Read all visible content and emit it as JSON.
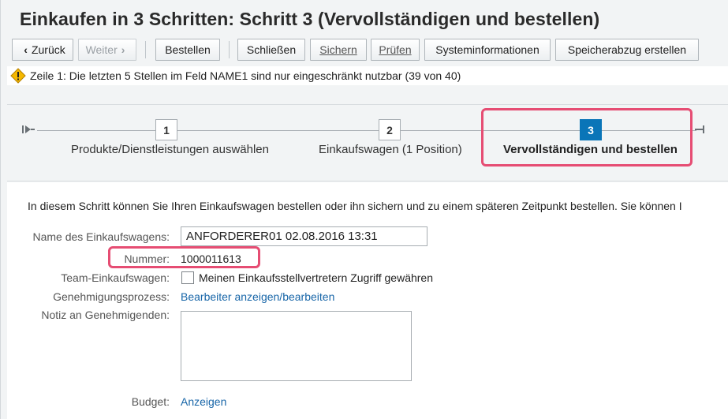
{
  "title": "Einkaufen in 3 Schritten: Schritt 3  (Vervollständigen und bestellen)",
  "toolbar": {
    "back_label": "Zurück",
    "next_label": "Weiter",
    "order_label": "Bestellen",
    "close_label": "Schließen",
    "save_label": "Sichern",
    "check_label": "Prüfen",
    "sysinfo_label": "Systeminformationen",
    "dump_label": "Speicherabzug erstellen"
  },
  "message": {
    "type": "warning",
    "icon": "warning-icon",
    "text": "Zeile 1: Die letzten 5 Stellen im Feld NAME1 sind nur eingeschränkt nutzbar (39 von 40)"
  },
  "steps": [
    {
      "number": "1",
      "label": "Produkte/Dienstleistungen auswählen",
      "active": false
    },
    {
      "number": "2",
      "label": "Einkaufswagen (1 Position)",
      "active": false
    },
    {
      "number": "3",
      "label": "Vervollständigen und bestellen",
      "active": true
    }
  ],
  "intro_text": "In diesem Schritt können Sie Ihren Einkaufswagen bestellen oder ihn sichern und zu einem späteren Zeitpunkt bestellen. Sie können I",
  "form": {
    "cart_name_label": "Name des Einkaufswagens:",
    "cart_name_value": "ANFORDERER01 02.08.2016 13:31",
    "number_label": "Nummer:",
    "number_value": "1000011613",
    "team_label": "Team-Einkaufswagen:",
    "team_checkbox_label": "Meinen Einkaufsstellvertretern Zugriff gewähren",
    "team_checked": false,
    "approval_label": "Genehmigungsprozess:",
    "approval_link": "Bearbeiter anzeigen/bearbeiten",
    "note_label": "Notiz an Genehmigenden:",
    "note_value": "",
    "budget_label": "Budget:",
    "budget_link": "Anzeigen"
  },
  "colors": {
    "accent": "#0a75b8",
    "highlight": "#e64d73",
    "link": "#1866a8",
    "warning": "#f5b800"
  }
}
